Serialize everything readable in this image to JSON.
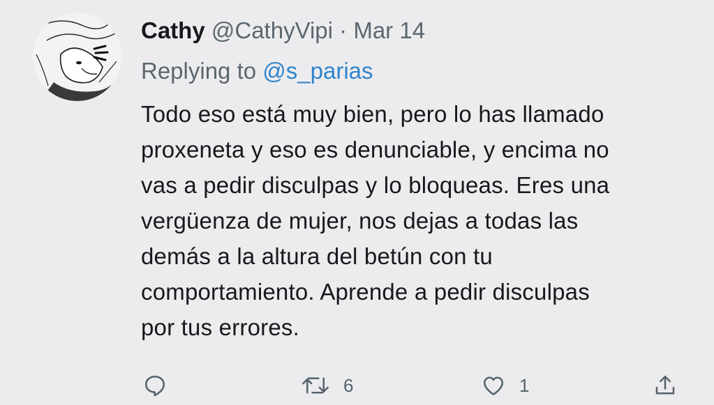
{
  "tweet": {
    "name": "Cathy",
    "handle": "@CathyVipi",
    "separator": "·",
    "date": "Mar 14",
    "replying_prefix": "Replying to",
    "replying_to": "@s_parias",
    "body_lines": [
      "Todo eso está muy bien, pero lo has llamado",
      "proxeneta y eso es denunciable, y encima no",
      "vas a pedir disculpas y lo bloqueas. Eres una",
      "vergüenza de mujer, nos dejas a todas las",
      "demás a la altura del betún con tu",
      "comportamiento. Aprende a pedir disculpas",
      "por tus errores."
    ]
  },
  "actions": {
    "reply_icon": "comment-icon",
    "retweet_icon": "retweet-icon",
    "retweet_count": "6",
    "like_icon": "heart-icon",
    "like_count": "1",
    "share_icon": "share-icon"
  },
  "colors": {
    "background": "#ececee",
    "mention": "#2f84cc",
    "secondary_text": "#5b6670"
  }
}
